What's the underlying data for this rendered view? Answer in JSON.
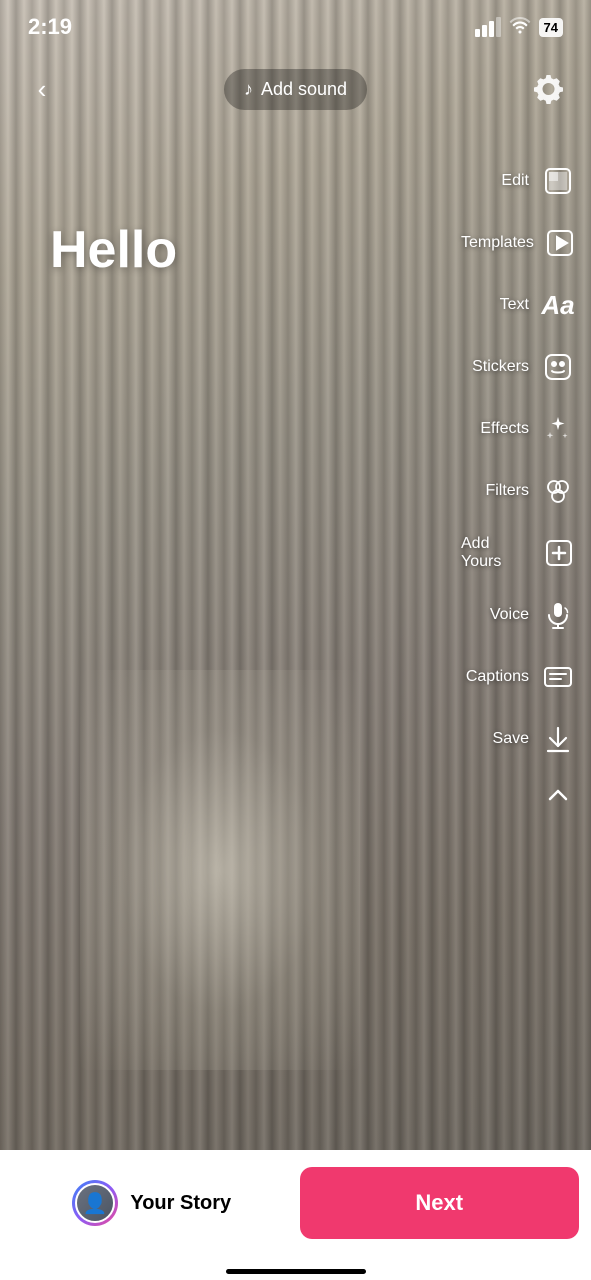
{
  "statusBar": {
    "time": "2:19",
    "battery": "74"
  },
  "topBar": {
    "addSoundLabel": "Add sound",
    "backLabel": "back"
  },
  "canvas": {
    "helloText": "Hello"
  },
  "toolbar": {
    "items": [
      {
        "id": "edit",
        "label": "Edit"
      },
      {
        "id": "templates",
        "label": "Templates"
      },
      {
        "id": "text",
        "label": "Text"
      },
      {
        "id": "stickers",
        "label": "Stickers"
      },
      {
        "id": "effects",
        "label": "Effects"
      },
      {
        "id": "filters",
        "label": "Filters"
      },
      {
        "id": "add-yours",
        "label": "Add Yours"
      },
      {
        "id": "voice",
        "label": "Voice"
      },
      {
        "id": "captions",
        "label": "Captions"
      },
      {
        "id": "save",
        "label": "Save"
      }
    ]
  },
  "bottomBar": {
    "yourStoryLabel": "Your Story",
    "nextLabel": "Next"
  }
}
